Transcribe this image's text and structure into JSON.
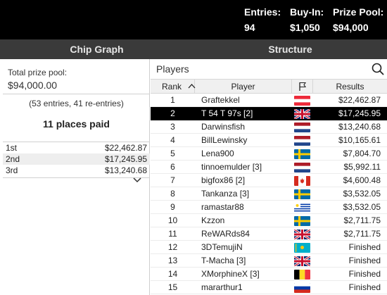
{
  "header": {
    "entries_label": "Entries:",
    "entries_value": "94",
    "buyin_label": "Buy-In:",
    "buyin_value": "$1,050",
    "prize_label": "Prize Pool:",
    "prize_value": "$94,000"
  },
  "tabs": [
    {
      "label": "Chip Graph"
    },
    {
      "label": "Structure"
    }
  ],
  "left": {
    "prize_label": "Total prize pool:",
    "prize_value": "$94,000.00",
    "entries_note": "(53 entries, 41 re-entries)",
    "places_paid": "11 places paid",
    "payouts": [
      {
        "place": "1st",
        "amount": "$22,462.87"
      },
      {
        "place": "2nd",
        "amount": "$17,245.95"
      },
      {
        "place": "3rd",
        "amount": "$13,240.68"
      }
    ],
    "expand_icon": "chevron-down-icon"
  },
  "players": {
    "title": "Players",
    "search_icon": "search-icon",
    "columns": {
      "rank": "Rank",
      "player": "Player",
      "flag_icon": "flag-icon",
      "results": "Results"
    },
    "rows": [
      {
        "rank": "1",
        "name": "Graftekkel",
        "country": "AT",
        "result": "$22,462.87"
      },
      {
        "rank": "2",
        "name": "T 54 T 97s [2]",
        "country": "GB",
        "result": "$17,245.95",
        "selected": true
      },
      {
        "rank": "3",
        "name": "Darwinsfish",
        "country": "NL",
        "result": "$13,240.68"
      },
      {
        "rank": "4",
        "name": "BillLewinsky",
        "country": "NL",
        "result": "$10,165.61"
      },
      {
        "rank": "5",
        "name": "Lena900",
        "country": "SE",
        "result": "$7,804.70"
      },
      {
        "rank": "6",
        "name": "tinnoemulder [3]",
        "country": "NL",
        "result": "$5,992.11"
      },
      {
        "rank": "7",
        "name": "bigfox86 [2]",
        "country": "CA",
        "result": "$4,600.48"
      },
      {
        "rank": "8",
        "name": "Tankanza [3]",
        "country": "SE",
        "result": "$3,532.05"
      },
      {
        "rank": "9",
        "name": "ramastar88",
        "country": "UY",
        "result": "$3,532.05"
      },
      {
        "rank": "10",
        "name": "Kzzon",
        "country": "SE",
        "result": "$2,711.75"
      },
      {
        "rank": "11",
        "name": "ReWARds84",
        "country": "GB",
        "result": "$2,711.75"
      },
      {
        "rank": "12",
        "name": "3DTemujiN",
        "country": "KZ",
        "result": "Finished"
      },
      {
        "rank": "13",
        "name": "T-Macha [3]",
        "country": "GB",
        "result": "Finished"
      },
      {
        "rank": "14",
        "name": "XMorphineX [3]",
        "country": "BE",
        "result": "Finished"
      },
      {
        "rank": "15",
        "name": "mararthur1",
        "country": "RU",
        "result": "Finished"
      }
    ]
  },
  "colors": {
    "header_bg": "#000000",
    "tab_bg": "#3a3a3a",
    "selected_row_bg": "#000000",
    "table_header_bg": "#f0f0f0"
  }
}
